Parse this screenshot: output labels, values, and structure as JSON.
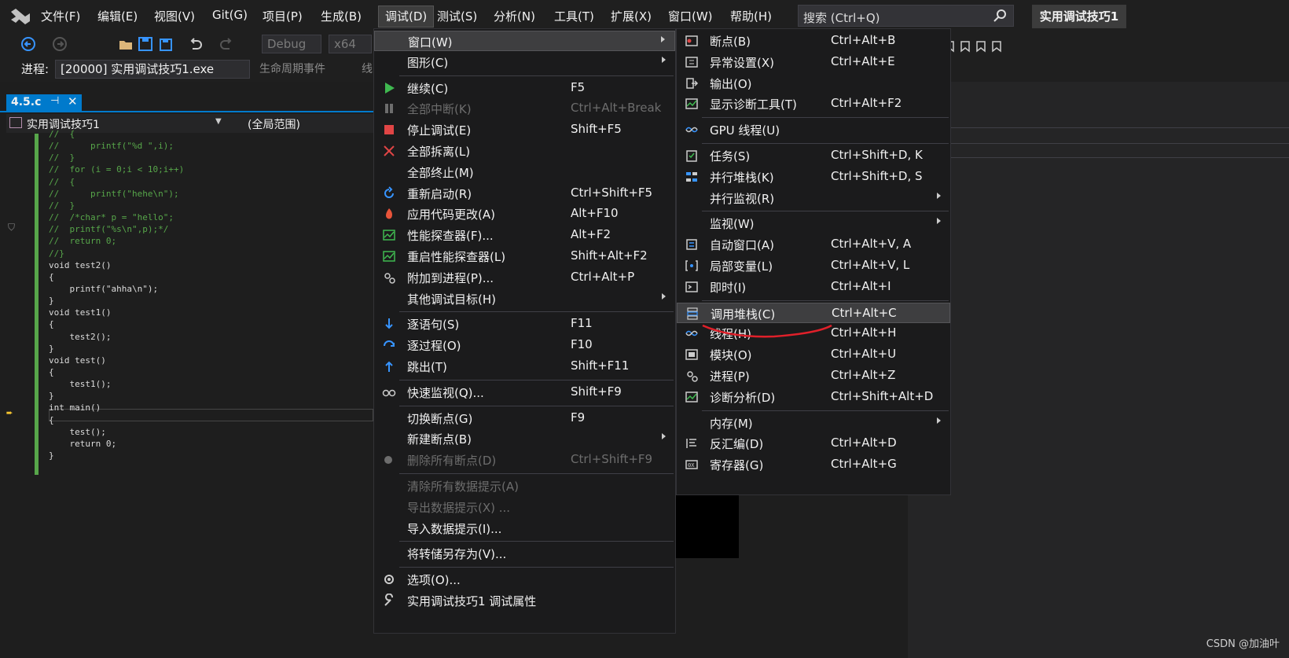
{
  "menubar": {
    "items": [
      "文件(F)",
      "编辑(E)",
      "视图(V)",
      "Git(G)",
      "项目(P)",
      "生成(B)",
      "调试(D)",
      "测试(S)",
      "分析(N)",
      "工具(T)",
      "扩展(X)",
      "窗口(W)",
      "帮助(H)"
    ],
    "active": "调试(D)",
    "search_placeholder": "搜索 (Ctrl+Q)",
    "solution_title": "实用调试技巧1"
  },
  "toolbar": {
    "config": "Debug",
    "platform": "x64",
    "process_label": "进程:",
    "process_value": "[20000] 实用调试技巧1.exe",
    "lifecycle": "生命周期事件",
    "extra": "线"
  },
  "editor": {
    "tab_title": "4.5.c",
    "project_combo": "实用调试技巧1",
    "scope_combo": "(全局范围)",
    "lines": [
      {
        "text": "//  {",
        "cls": "c-comment"
      },
      {
        "text": "//      printf(\"%d \",i);",
        "cls": "c-comment"
      },
      {
        "text": "//  }",
        "cls": "c-comment"
      },
      {
        "text": "//  for (i = 0;i < 10;i++)",
        "cls": "c-comment"
      },
      {
        "text": "//  {",
        "cls": "c-comment"
      },
      {
        "text": "//      printf(\"hehe\\n\");",
        "cls": "c-comment"
      },
      {
        "text": "//  }",
        "cls": "c-comment"
      },
      {
        "text": "//  /*char* p = \"hello\";",
        "cls": "c-comment"
      },
      {
        "text": "//  printf(\"%s\\n\",p);*/",
        "cls": "c-comment"
      },
      {
        "text": "//  return 0;",
        "cls": "c-comment"
      },
      {
        "text": "//}",
        "cls": "c-comment"
      },
      {
        "text": "void test2()",
        "cls": "c-plain"
      },
      {
        "text": "{",
        "cls": "c-plain"
      },
      {
        "text": "    printf(\"ahha\\n\");",
        "cls": "c-plain"
      },
      {
        "text": "}",
        "cls": "c-plain"
      },
      {
        "text": "void test1()",
        "cls": "c-plain"
      },
      {
        "text": "{",
        "cls": "c-plain"
      },
      {
        "text": "    test2();",
        "cls": "c-plain"
      },
      {
        "text": "}",
        "cls": "c-plain"
      },
      {
        "text": "void test()",
        "cls": "c-plain"
      },
      {
        "text": "{",
        "cls": "c-plain"
      },
      {
        "text": "    test1();",
        "cls": "c-plain"
      },
      {
        "text": "}",
        "cls": "c-plain"
      },
      {
        "text": "int main()",
        "cls": "c-plain"
      },
      {
        "text": "{",
        "cls": "c-plain"
      },
      {
        "text": "    test();",
        "cls": "c-plain"
      },
      {
        "text": "    return 0;",
        "cls": "c-plain"
      },
      {
        "text": "}",
        "cls": "c-plain"
      }
    ]
  },
  "debug_menu": {
    "items": [
      {
        "label": "窗口(W)",
        "shortcut": "",
        "submenu": true,
        "highlight": true
      },
      {
        "label": "图形(C)",
        "shortcut": "",
        "submenu": true
      },
      {
        "label": "继续(C)",
        "shortcut": "F5",
        "icon": "play-icon"
      },
      {
        "label": "全部中断(K)",
        "shortcut": "Ctrl+Alt+Break",
        "disabled": true,
        "icon": "pause-icon"
      },
      {
        "label": "停止调试(E)",
        "shortcut": "Shift+F5",
        "icon": "stop-icon"
      },
      {
        "label": "全部拆离(L)",
        "shortcut": "",
        "icon": "detach-icon"
      },
      {
        "label": "全部终止(M)",
        "shortcut": ""
      },
      {
        "label": "重新启动(R)",
        "shortcut": "Ctrl+Shift+F5",
        "icon": "restart-icon"
      },
      {
        "label": "应用代码更改(A)",
        "shortcut": "Alt+F10",
        "icon": "hot-reload-icon"
      },
      {
        "label": "性能探查器(F)...",
        "shortcut": "Alt+F2",
        "icon": "profiler-icon"
      },
      {
        "label": "重启性能探查器(L)",
        "shortcut": "Shift+Alt+F2",
        "icon": "profiler-restart-icon"
      },
      {
        "label": "附加到进程(P)...",
        "shortcut": "Ctrl+Alt+P",
        "icon": "attach-icon"
      },
      {
        "label": "其他调试目标(H)",
        "shortcut": "",
        "submenu": true
      },
      {
        "label": "逐语句(S)",
        "shortcut": "F11",
        "icon": "step-into-icon"
      },
      {
        "label": "逐过程(O)",
        "shortcut": "F10",
        "icon": "step-over-icon"
      },
      {
        "label": "跳出(T)",
        "shortcut": "Shift+F11",
        "icon": "step-out-icon"
      },
      {
        "label": "快速监视(Q)...",
        "shortcut": "Shift+F9",
        "icon": "quickwatch-icon"
      },
      {
        "label": "切换断点(G)",
        "shortcut": "F9"
      },
      {
        "label": "新建断点(B)",
        "shortcut": "",
        "submenu": true
      },
      {
        "label": "删除所有断点(D)",
        "shortcut": "Ctrl+Shift+F9",
        "disabled": true,
        "icon": "delete-breakpoints-icon"
      },
      {
        "label": "清除所有数据提示(A)",
        "shortcut": "",
        "disabled": true
      },
      {
        "label": "导出数据提示(X) ...",
        "shortcut": "",
        "disabled": true
      },
      {
        "label": "导入数据提示(I)...",
        "shortcut": ""
      },
      {
        "label": "将转储另存为(V)...",
        "shortcut": ""
      },
      {
        "label": "选项(O)...",
        "shortcut": "",
        "icon": "gear-icon"
      },
      {
        "label": "实用调试技巧1 调试属性",
        "shortcut": "",
        "icon": "wrench-icon"
      }
    ]
  },
  "window_submenu": {
    "items": [
      {
        "label": "断点(B)",
        "shortcut": "Ctrl+Alt+B",
        "icon": "breakpoints-icon"
      },
      {
        "label": "异常设置(X)",
        "shortcut": "Ctrl+Alt+E",
        "icon": "exception-icon"
      },
      {
        "label": "输出(O)",
        "shortcut": "",
        "icon": "output-icon"
      },
      {
        "label": "显示诊断工具(T)",
        "shortcut": "Ctrl+Alt+F2",
        "icon": "diagnostic-icon"
      },
      {
        "label": "GPU 线程(U)",
        "shortcut": "",
        "icon": "gpu-thread-icon"
      },
      {
        "label": "任务(S)",
        "shortcut": "Ctrl+Shift+D, K",
        "icon": "tasks-icon"
      },
      {
        "label": "并行堆栈(K)",
        "shortcut": "Ctrl+Shift+D, S",
        "icon": "parallel-stacks-icon"
      },
      {
        "label": "并行监视(R)",
        "shortcut": "",
        "submenu": true
      },
      {
        "label": "监视(W)",
        "shortcut": "",
        "submenu": true
      },
      {
        "label": "自动窗口(A)",
        "shortcut": "Ctrl+Alt+V, A",
        "icon": "autos-icon"
      },
      {
        "label": "局部变量(L)",
        "shortcut": "Ctrl+Alt+V, L",
        "icon": "locals-icon"
      },
      {
        "label": "即时(I)",
        "shortcut": "Ctrl+Alt+I",
        "icon": "immediate-icon"
      },
      {
        "label": "调用堆栈(C)",
        "shortcut": "Ctrl+Alt+C",
        "icon": "call-stack-icon",
        "highlight": true
      },
      {
        "label": "线程(H)",
        "shortcut": "Ctrl+Alt+H",
        "icon": "threads-icon"
      },
      {
        "label": "模块(O)",
        "shortcut": "Ctrl+Alt+U",
        "icon": "modules-icon"
      },
      {
        "label": "进程(P)",
        "shortcut": "Ctrl+Alt+Z",
        "icon": "processes-icon"
      },
      {
        "label": "诊断分析(D)",
        "shortcut": "Ctrl+Shift+Alt+D",
        "icon": "diagnostic-analysis-icon"
      },
      {
        "label": "内存(M)",
        "shortcut": "",
        "submenu": true
      },
      {
        "label": "反汇编(D)",
        "shortcut": "Ctrl+Alt+D",
        "icon": "disassembly-icon"
      },
      {
        "label": "寄存器(G)",
        "shortcut": "Ctrl+Alt+G",
        "icon": "registers-icon"
      }
    ]
  },
  "watermark": "CSDN @加油叶",
  "colors": {
    "accent": "#007acc",
    "annotation": "#e0202a"
  }
}
